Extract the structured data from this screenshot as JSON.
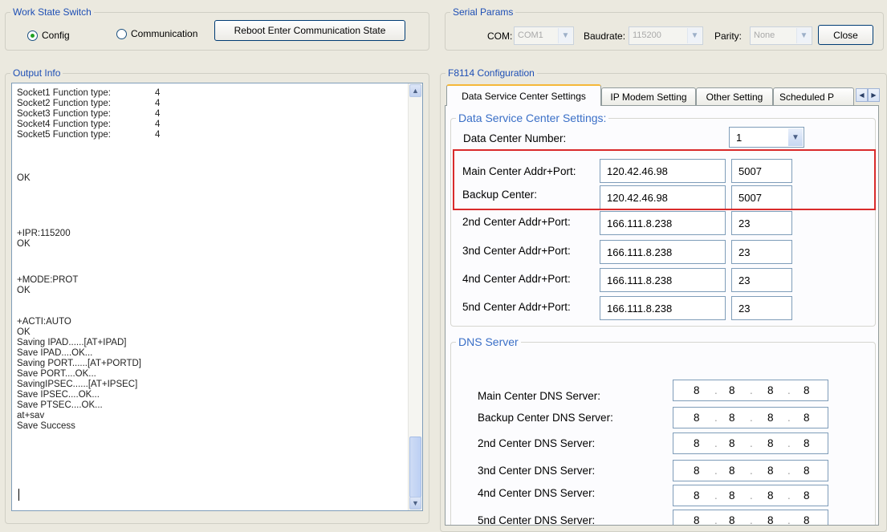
{
  "work_state": {
    "title": "Work State Switch",
    "config_label": "Config",
    "communication_label": "Communication",
    "reboot_label": "Reboot Enter Communication State",
    "selected": "Config"
  },
  "serial": {
    "title": "Serial Params",
    "com_label": "COM:",
    "com_value": "COM1",
    "baud_label": "Baudrate:",
    "baud_value": "115200",
    "parity_label": "Parity:",
    "parity_value": "None",
    "close_label": "Close"
  },
  "output": {
    "title": "Output Info",
    "lines": [
      {
        "label": "Socket1 Function type:",
        "value": "4"
      },
      {
        "label": "Socket2 Function type:",
        "value": "4"
      },
      {
        "label": "Socket3 Function type:",
        "value": "4"
      },
      {
        "label": "Socket4 Function type:",
        "value": "4"
      },
      {
        "label": "Socket5 Function type:",
        "value": "4"
      }
    ],
    "text": [
      "OK",
      "+IPR:115200",
      "OK",
      "+MODE:PROT",
      "OK",
      "+ACTI:AUTO",
      "OK",
      "Saving IPAD......[AT+IPAD]",
      "Save IPAD....OK...",
      "Saving PORT......[AT+PORTD]",
      "Save PORT....OK...",
      "SavingIPSEC......[AT+IPSEC]",
      "Save IPSEC....OK...",
      "Save PTSEC....OK...",
      "at+sav",
      "Save Success"
    ]
  },
  "config": {
    "title": "F8114 Configuration",
    "tabs": [
      "Data Service Center Settings",
      "IP Modem Setting",
      "Other Setting",
      "Scheduled P"
    ],
    "active_tab": "Data Service Center Settings",
    "section_title": "Data Service Center Settings:",
    "dc_number_label": "Data Center Number:",
    "dc_number_value": "1",
    "centers": [
      {
        "label": "Main Center Addr+Port:",
        "ip": "120.42.46.98",
        "port": "5007"
      },
      {
        "label": "Backup Center:",
        "ip": "120.42.46.98",
        "port": "5007"
      },
      {
        "label": "2nd Center Addr+Port:",
        "ip": "166.111.8.238",
        "port": "23"
      },
      {
        "label": "3nd Center Addr+Port:",
        "ip": "166.111.8.238",
        "port": "23"
      },
      {
        "label": "4nd Center Addr+Port:",
        "ip": "166.111.8.238",
        "port": "23"
      },
      {
        "label": "5nd Center Addr+Port:",
        "ip": "166.111.8.238",
        "port": "23"
      }
    ],
    "dns_title": "DNS Server",
    "dns": [
      {
        "label": "Main Center DNS Server:",
        "octets": [
          "8",
          "8",
          "8",
          "8"
        ]
      },
      {
        "label": "Backup Center DNS Server:",
        "octets": [
          "8",
          "8",
          "8",
          "8"
        ]
      },
      {
        "label": "2nd Center DNS Server:",
        "octets": [
          "8",
          "8",
          "8",
          "8"
        ]
      },
      {
        "label": "3nd Center DNS Server:",
        "octets": [
          "8",
          "8",
          "8",
          "8"
        ]
      },
      {
        "label": "4nd Center DNS Server:",
        "octets": [
          "8",
          "8",
          "8",
          "8"
        ]
      },
      {
        "label": "5nd Center DNS Server:",
        "octets": [
          "8",
          "8",
          "8",
          "8"
        ]
      }
    ]
  },
  "colors": {
    "group_title": "#1e4fb5",
    "highlight": "#d92b2b",
    "active_tab_top": "#f5b839"
  }
}
